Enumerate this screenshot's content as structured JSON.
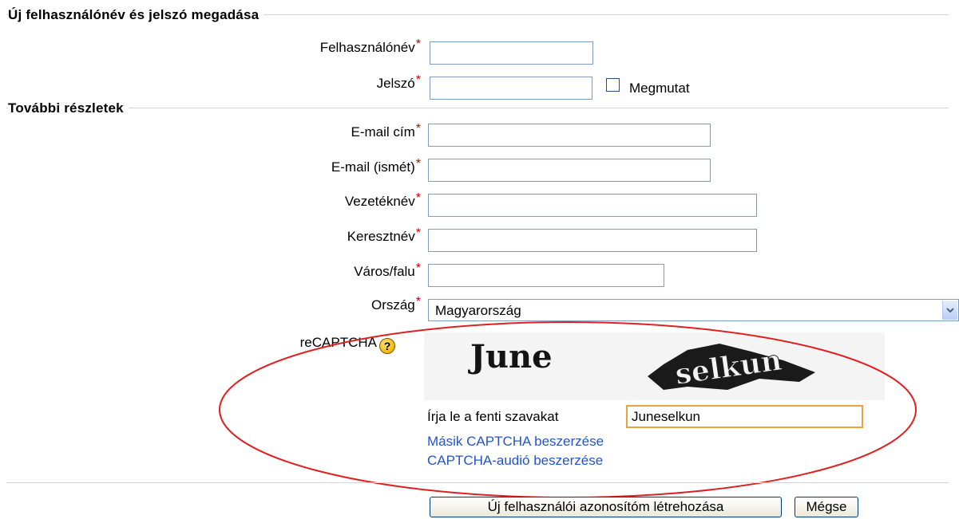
{
  "sections": {
    "login": "Új felhasználónév és jelszó megadása",
    "details": "További részletek"
  },
  "fields": {
    "username": {
      "label": "Felhasználónév",
      "value": ""
    },
    "password": {
      "label": "Jelszó",
      "value": "",
      "show_label": "Megmutat"
    },
    "email": {
      "label": "E-mail cím",
      "value": ""
    },
    "email2": {
      "label": "E-mail (ismét)",
      "value": ""
    },
    "lastname": {
      "label": "Vezetéknév",
      "value": ""
    },
    "firstname": {
      "label": "Keresztnév",
      "value": ""
    },
    "city": {
      "label": "Város/falu",
      "value": ""
    },
    "country": {
      "label": "Ország",
      "value": "Magyarország"
    }
  },
  "required_mark": "*",
  "recaptcha": {
    "label": "reCAPTCHA",
    "help_icon": "?",
    "word1": "June",
    "word2": "selkun",
    "prompt": "Írja le a fenti szavakat",
    "response": "Juneselkun",
    "link_other": "Másik CAPTCHA beszerzése",
    "link_audio": "CAPTCHA-audió beszerzése"
  },
  "buttons": {
    "submit": "Új felhasználói azonosítóm létrehozása",
    "cancel": "Mégse"
  },
  "colors": {
    "required": "#cc0000",
    "link": "#2255cc",
    "highlight_ellipse": "#e02020",
    "captcha_input_border": "#e8a33d"
  }
}
